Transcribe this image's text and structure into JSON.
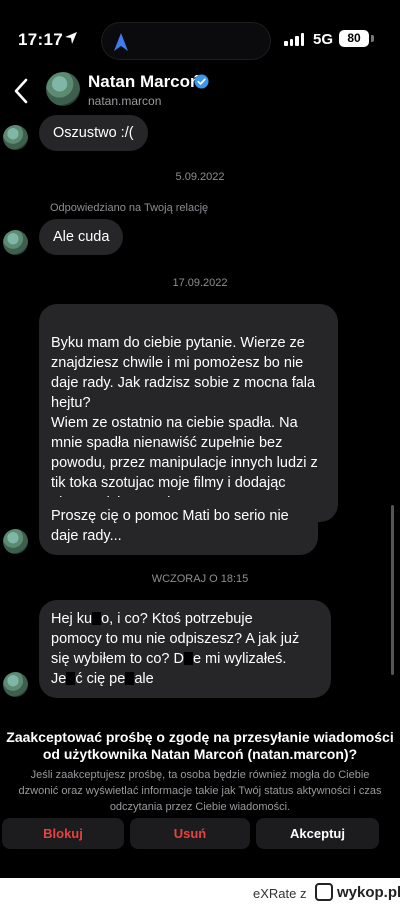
{
  "status_bar": {
    "time": "17:17",
    "network": "5G",
    "battery": "80"
  },
  "header": {
    "name": "Natan Marcoń",
    "username": "natan.marcon"
  },
  "messages": [
    {
      "text": "Oszustwo :/("
    },
    {
      "separator": "5.09.2022"
    },
    {
      "reply_note": "Odpowiedziano na Twoją relację"
    },
    {
      "text": "Ale cuda"
    },
    {
      "separator": "17.09.2022"
    },
    {
      "text": "Byku mam do ciebie pytanie. Wierze ze znajdziesz chwile i mi pomożesz bo nie daje rady. Jak radzisz sobie z mocna fala hejtu?\nWiem ze ostatnio na ciebie spadła. Na mnie spadła nienawiść zupełnie bez powodu, przez manipulacje innych ludzi z tik toka szotujac moje filmy i dodając nieprawdziwe napisy."
    },
    {
      "text": "Proszę cię o pomoc Mati bo serio nie daje rady..."
    },
    {
      "separator": "WCZORAJ O 18:15"
    },
    {
      "text_parts": [
        "Hej ku",
        "o, i co? Ktoś potrzebuje",
        "pomocy to mu nie odpiszesz? A jak już",
        "się wybiłem to co? D",
        "e mi wylizałeś.",
        "Je",
        "ć cię pe",
        "ale"
      ]
    }
  ],
  "request": {
    "title": "Zaakceptować prośbę o zgodę na przesyłanie wiadomości od użytkownika Natan Marcoń (natan.marcon)?",
    "body": "Jeśli zaakceptujesz prośbę, ta osoba będzie również mogła do Ciebie dzwonić oraz wyświetlać informacje takie jak Twój status aktywności i czas odczytania przez Ciebie wiadomości.",
    "buttons": {
      "block": "Blokuj",
      "delete": "Usuń",
      "accept": "Akceptuj"
    },
    "danger_color": "#e8413f"
  },
  "footer": {
    "text": "eXRate  z",
    "logo": "wykop.pl"
  },
  "icons": [
    "location-arrow-icon",
    "navigation-icon",
    "signal-icon",
    "battery-icon",
    "back-chevron-icon",
    "verified-badge-icon",
    "wykop-logo-icon"
  ]
}
